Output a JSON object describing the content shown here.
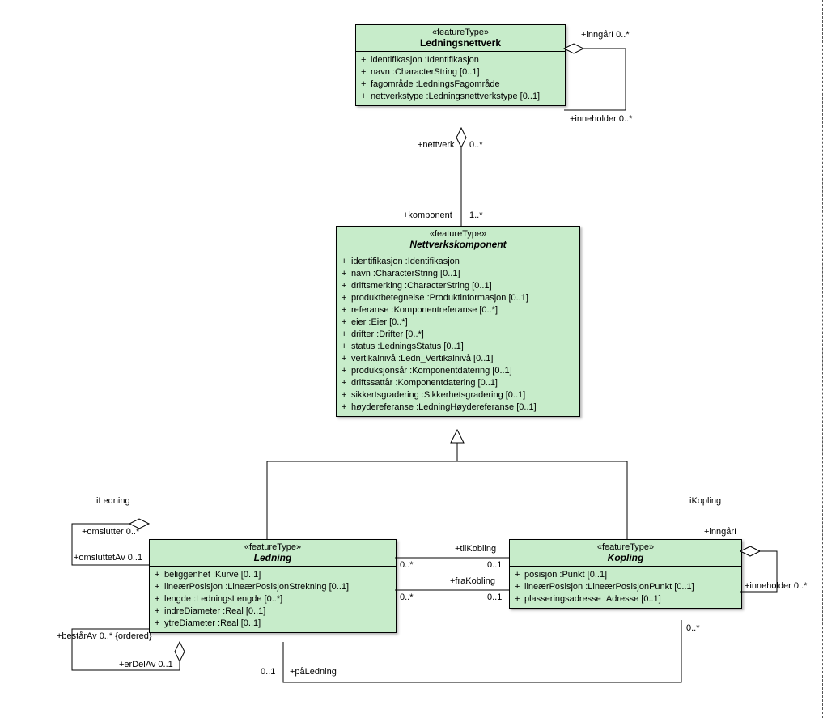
{
  "classes": {
    "ledningsnettverk": {
      "stereo": "«featureType»",
      "name": "Ledningsnettverk",
      "attrs": [
        "identifikasjon  :Identifikasjon",
        "navn  :CharacterString [0..1]",
        "fagområde  :LedningsFagområde",
        "nettverkstype  :Ledningsnettverkstype [0..1]"
      ]
    },
    "nettverkskomponent": {
      "stereo": "«featureType»",
      "name": "Nettverkskomponent",
      "attrs": [
        "identifikasjon  :Identifikasjon",
        "navn  :CharacterString [0..1]",
        "driftsmerking  :CharacterString [0..1]",
        "produktbetegnelse  :Produktinformasjon [0..1]",
        "referanse  :Komponentreferanse [0..*]",
        "eier  :Eier [0..*]",
        "drifter  :Drifter [0..*]",
        "status  :LedningsStatus [0..1]",
        "vertikalnivå  :Ledn_Vertikalnivå [0..1]",
        "produksjonsår  :Komponentdatering [0..1]",
        "driftssattår  :Komponentdatering [0..1]",
        "sikkertsgradering  :Sikkerhetsgradering [0..1]",
        "høydereferanse  :LedningHøydereferanse [0..1]"
      ]
    },
    "ledning": {
      "stereo": "«featureType»",
      "name": "Ledning",
      "attrs": [
        "beliggenhet  :Kurve [0..1]",
        "lineærPosisjon  :LineærPosisjonStrekning [0..1]",
        "lengde  :LedningsLengde [0..*]",
        "indreDiameter  :Real [0..1]",
        "ytreDiameter  :Real [0..1]"
      ]
    },
    "kopling": {
      "stereo": "«featureType»",
      "name": "Kopling",
      "attrs": [
        "posisjon  :Punkt [0..1]",
        "lineærPosisjon  :LineærPosisjonPunkt [0..1]",
        "plasseringsadresse  :Adresse [0..1]"
      ]
    }
  },
  "labels": {
    "inngarI_top": "+inngårI 0..*",
    "inneholder_top": "+inneholder 0..*",
    "nettverk": "+nettverk",
    "komponent": "+komponent",
    "m_0s": "0..*",
    "m_1s": "1..*",
    "iLedning": "iLedning",
    "iKopling": "iKopling",
    "omslutter": "+omslutter 0..*",
    "omsluttetAv": "+omsluttetAv 0..1",
    "tilKobling": "+tilKobling",
    "fraKobling": "+fraKobling",
    "m_01": "0..1",
    "inngarI_r": "+inngårI",
    "inneholder_r": "+inneholder 0..*",
    "bestarAv": "+bestårAv 0..* {ordered}",
    "erDelAv": "+erDelAv 0..1",
    "paLedning": "+påLedning"
  }
}
